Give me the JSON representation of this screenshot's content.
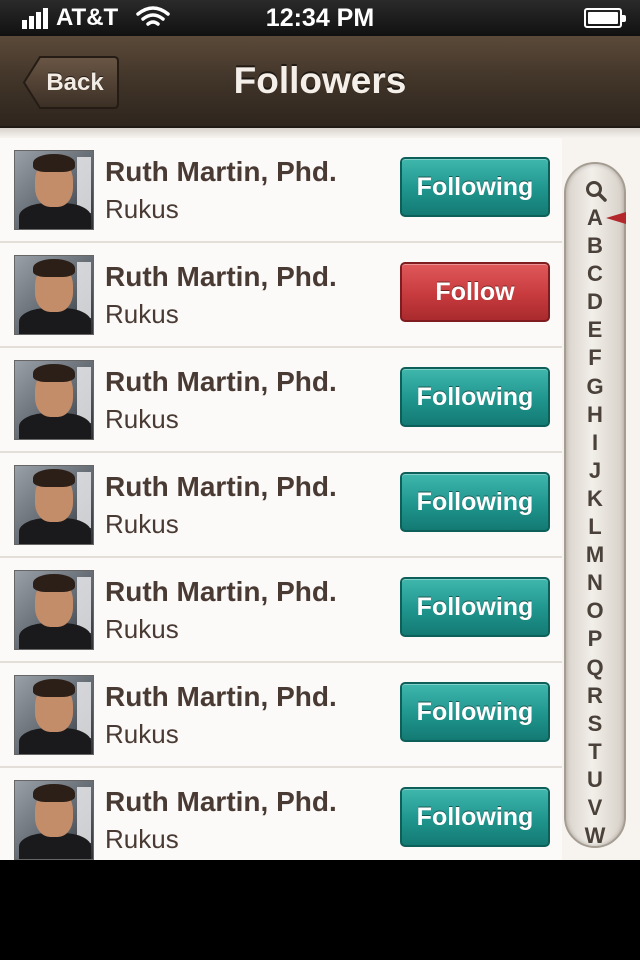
{
  "status_bar": {
    "carrier": "AT&T",
    "time": "12:34 PM"
  },
  "nav": {
    "back_label": "Back",
    "title": "Followers"
  },
  "rows": [
    {
      "name": "Ruth Martin, Phd.",
      "handle": "Rukus",
      "button": "Following",
      "state": "following"
    },
    {
      "name": "Ruth Martin, Phd.",
      "handle": "Rukus",
      "button": "Follow",
      "state": "follow"
    },
    {
      "name": "Ruth Martin, Phd.",
      "handle": "Rukus",
      "button": "Following",
      "state": "following"
    },
    {
      "name": "Ruth Martin, Phd.",
      "handle": "Rukus",
      "button": "Following",
      "state": "following"
    },
    {
      "name": "Ruth Martin, Phd.",
      "handle": "Rukus",
      "button": "Following",
      "state": "following"
    },
    {
      "name": "Ruth Martin, Phd.",
      "handle": "Rukus",
      "button": "Following",
      "state": "following"
    },
    {
      "name": "Ruth Martin, Phd.",
      "handle": "Rukus",
      "button": "Following",
      "state": "following"
    }
  ],
  "index": {
    "icon": "search-icon",
    "letters": [
      "A",
      "B",
      "C",
      "D",
      "E",
      "F",
      "G",
      "H",
      "I",
      "J",
      "K",
      "L",
      "M",
      "N",
      "O",
      "P",
      "Q",
      "R",
      "S",
      "T",
      "U",
      "V",
      "W"
    ]
  },
  "colors": {
    "following": "#1f958d",
    "follow": "#c73b3e",
    "nav": "#43362a"
  }
}
